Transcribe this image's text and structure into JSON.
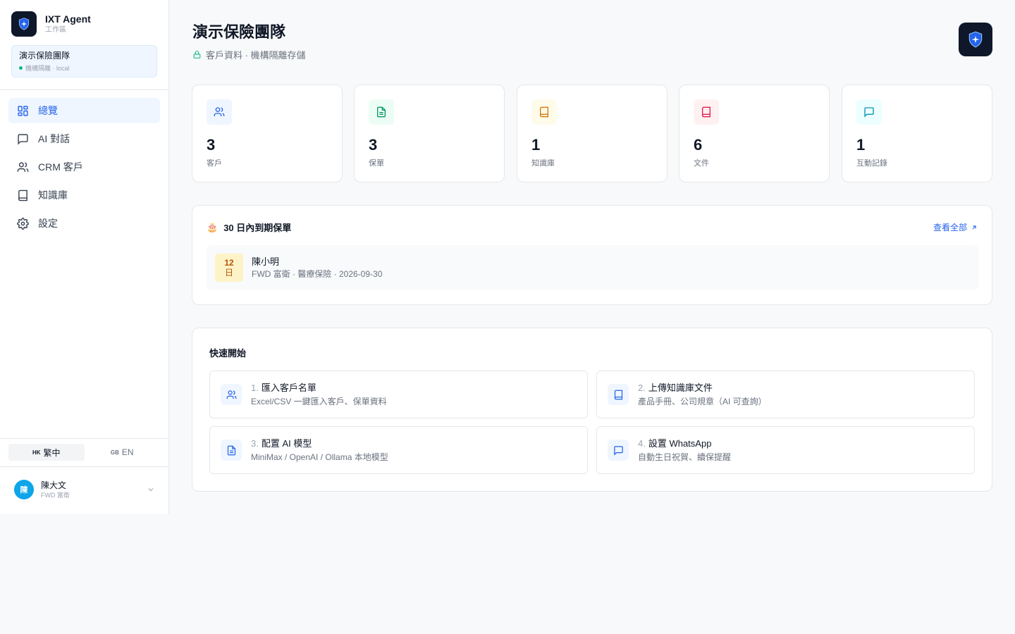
{
  "app": {
    "title": "IXT Agent",
    "subtitle": "工作區"
  },
  "team": {
    "name": "演示保險團隊",
    "meta": "機構隔離 · local"
  },
  "nav": [
    {
      "label": "總覽",
      "icon": "grid-icon",
      "active": true
    },
    {
      "label": "AI 對話",
      "icon": "chat-icon",
      "active": false
    },
    {
      "label": "CRM 客戶",
      "icon": "users-icon",
      "active": false
    },
    {
      "label": "知識庫",
      "icon": "book-icon",
      "active": false
    },
    {
      "label": "設定",
      "icon": "gear-icon",
      "active": false
    }
  ],
  "language": {
    "zh": {
      "flag": "HK",
      "label": "繁中"
    },
    "en": {
      "flag": "GB",
      "label": "EN"
    },
    "selected": "繁中"
  },
  "user": {
    "initial": "陳",
    "name": "陳大文",
    "org": "FWD 富衛"
  },
  "header": {
    "title": "演示保險團隊",
    "subtitle": "客戶資料 · 機構隔離存儲"
  },
  "stats": [
    {
      "value": "3",
      "label": "客戶",
      "icon": "users-icon",
      "color": "#2563eb",
      "bg": "#eff6ff"
    },
    {
      "value": "3",
      "label": "保單",
      "icon": "document-icon",
      "color": "#059669",
      "bg": "#ecfdf5"
    },
    {
      "value": "1",
      "label": "知識庫",
      "icon": "book-icon",
      "color": "#d97706",
      "bg": "#fffbeb"
    },
    {
      "value": "6",
      "label": "文件",
      "icon": "book-icon",
      "color": "#e11d48",
      "bg": "#fff1f2"
    },
    {
      "value": "1",
      "label": "互動記錄",
      "icon": "chat-icon",
      "color": "#0891b2",
      "bg": "#ecfeff"
    }
  ],
  "expiring": {
    "title": "30 日內到期保單",
    "icon": "🎂",
    "view_all": "查看全部",
    "items": [
      {
        "days_num": "12",
        "days_unit": "日",
        "name": "陳小明",
        "meta": "FWD 富衛 · 醫療保險 · 2026-09-30"
      }
    ]
  },
  "quickstart": {
    "title": "快速開始",
    "items": [
      {
        "num": "1.",
        "title": "匯入客戶名單",
        "desc": "Excel/CSV 一鍵匯入客戶、保單資料",
        "icon": "users-icon"
      },
      {
        "num": "2.",
        "title": "上傳知識庫文件",
        "desc": "產品手冊、公司規章（AI 可查詢）",
        "icon": "book-icon"
      },
      {
        "num": "3.",
        "title": "配置 AI 模型",
        "desc": "MiniMax / OpenAI / Ollama 本地模型",
        "icon": "document-icon"
      },
      {
        "num": "4.",
        "title": "設置 WhatsApp",
        "desc": "自動生日祝賀、續保提醒",
        "icon": "chat-icon"
      }
    ]
  },
  "colors": {
    "accent": "#2563eb",
    "brand_dark": "#0f172a",
    "online": "#10b981"
  }
}
